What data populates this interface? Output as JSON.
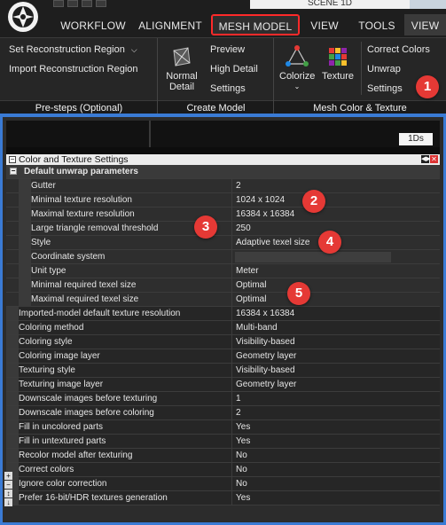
{
  "top": {
    "scene_label": "SCENE 1D",
    "tabs": [
      {
        "label": "WORKFLOW"
      },
      {
        "label": "ALIGNMENT"
      },
      {
        "label": "MESH MODEL"
      },
      {
        "label": "VIEW"
      },
      {
        "label": "TOOLS"
      },
      {
        "label": "VIEW"
      }
    ]
  },
  "ribbon": {
    "presteps": {
      "title": "Pre-steps (Optional)",
      "set_region": "Set Reconstruction Region",
      "import_region": "Import Reconstruction Region"
    },
    "create_model": {
      "title": "Create Model",
      "normal_detail_l1": "Normal",
      "normal_detail_l2": "Detail",
      "preview": "Preview",
      "high_detail": "High Detail",
      "settings": "Settings"
    },
    "color_texture": {
      "title": "Mesh Color & Texture",
      "colorize": "Colorize",
      "texture": "Texture",
      "correct_colors": "Correct Colors",
      "unwrap": "Unwrap",
      "settings": "Settings"
    }
  },
  "panel": {
    "badge": "1Ds",
    "title": "Color and Texture Settings",
    "group_title": "Default unwrap parameters",
    "sub_rows": [
      {
        "label": "Gutter",
        "value": "2"
      },
      {
        "label": "Minimal texture resolution",
        "value": "1024 x 1024"
      },
      {
        "label": "Maximal texture resolution",
        "value": "16384 x 16384"
      },
      {
        "label": "Large triangle removal threshold",
        "value": "250"
      },
      {
        "label": "Style",
        "value": "Adaptive texel size"
      },
      {
        "label": "Coordinate system",
        "value": ""
      },
      {
        "label": "Unit type",
        "value": "Meter"
      },
      {
        "label": "Minimal required texel size",
        "value": "Optimal"
      },
      {
        "label": "Maximal required texel size",
        "value": "Optimal"
      }
    ],
    "top_rows": [
      {
        "label": "Imported-model default texture resolution",
        "value": "16384 x 16384"
      },
      {
        "label": "Coloring method",
        "value": "Multi-band"
      },
      {
        "label": "Coloring style",
        "value": "Visibility-based"
      },
      {
        "label": "Coloring image layer",
        "value": "Geometry layer"
      },
      {
        "label": "Texturing style",
        "value": "Visibility-based"
      },
      {
        "label": "Texturing image layer",
        "value": "Geometry layer"
      },
      {
        "label": "Downscale images before texturing",
        "value": "1"
      },
      {
        "label": "Downscale images before coloring",
        "value": "2"
      },
      {
        "label": "Fill in uncolored parts",
        "value": "Yes"
      },
      {
        "label": "Fill in untextured parts",
        "value": "Yes"
      },
      {
        "label": "Recolor model after texturing",
        "value": "No"
      },
      {
        "label": "Correct colors",
        "value": "No"
      },
      {
        "label": "Ignore color correction",
        "value": "No"
      },
      {
        "label": "Prefer 16-bit/HDR textures generation",
        "value": "Yes"
      }
    ]
  },
  "markers": [
    "1",
    "2",
    "3",
    "4",
    "5"
  ],
  "colors": {
    "accent_blue": "#3a7bd5",
    "marker_red": "#e53935",
    "active_tab_outline": "#ff2a2a"
  }
}
